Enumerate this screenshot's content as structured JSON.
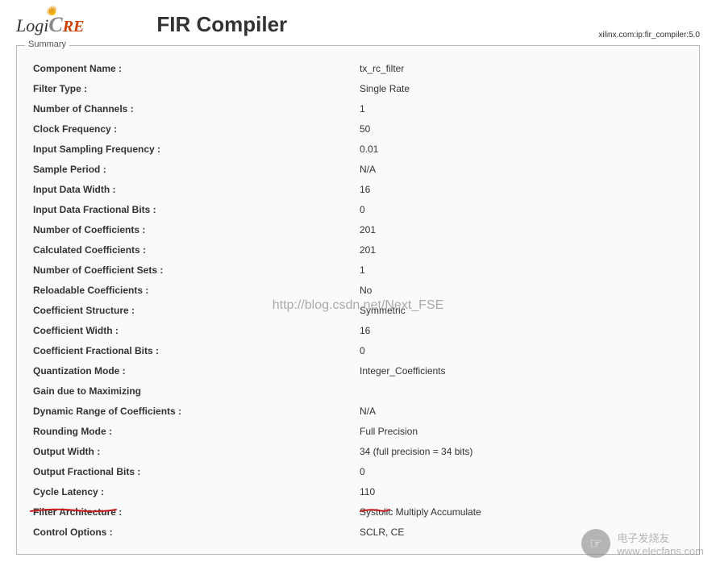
{
  "header": {
    "logo_logi": "Logi",
    "logo_c": "C",
    "logo_re": "RE",
    "title": "FIR Compiler",
    "ip_path": "xilinx.com:ip:fir_compiler:5.0"
  },
  "summary": {
    "legend": "Summary",
    "rows": [
      {
        "label": "Component Name :",
        "value": "tx_rc_filter"
      },
      {
        "label": "Filter Type :",
        "value": "Single Rate"
      },
      {
        "label": "Number of Channels :",
        "value": "1"
      },
      {
        "label": "Clock Frequency :",
        "value": "50"
      },
      {
        "label": "Input Sampling Frequency :",
        "value": "0.01"
      },
      {
        "label": "Sample Period :",
        "value": "N/A"
      },
      {
        "label": "Input Data Width :",
        "value": "16"
      },
      {
        "label": "Input Data Fractional Bits :",
        "value": "0"
      },
      {
        "label": "Number of Coefficients :",
        "value": "201"
      },
      {
        "label": "Calculated Coefficients :",
        "value": "201"
      },
      {
        "label": "Number of Coefficient Sets :",
        "value": "1"
      },
      {
        "label": "Reloadable Coefficients :",
        "value": "No"
      },
      {
        "label": "Coefficient Structure :",
        "value": "Symmetric"
      },
      {
        "label": "Coefficient Width :",
        "value": "16"
      },
      {
        "label": "Coefficient Fractional Bits :",
        "value": "0"
      },
      {
        "label": "Quantization Mode :",
        "value": "Integer_Coefficients"
      },
      {
        "label": "Gain due to Maximizing",
        "value": ""
      },
      {
        "label": "Dynamic Range of Coefficients :",
        "value": "N/A"
      },
      {
        "label": "Rounding Mode :",
        "value": "Full Precision"
      },
      {
        "label": "Output Width :",
        "value": "34 (full precision = 34 bits)"
      },
      {
        "label": "Output Fractional Bits :",
        "value": "0"
      },
      {
        "label": "Cycle Latency :",
        "value": "110"
      },
      {
        "label": "Filter Architecture :",
        "value": "Systolic Multiply Accumulate"
      },
      {
        "label": "Control Options :",
        "value": "SCLR, CE"
      }
    ]
  },
  "watermark": {
    "center": "http://blog.csdn.net/Next_FSE",
    "corner_text_top": "电子发烧友",
    "corner_text_bottom": "www.elecfans.com"
  }
}
